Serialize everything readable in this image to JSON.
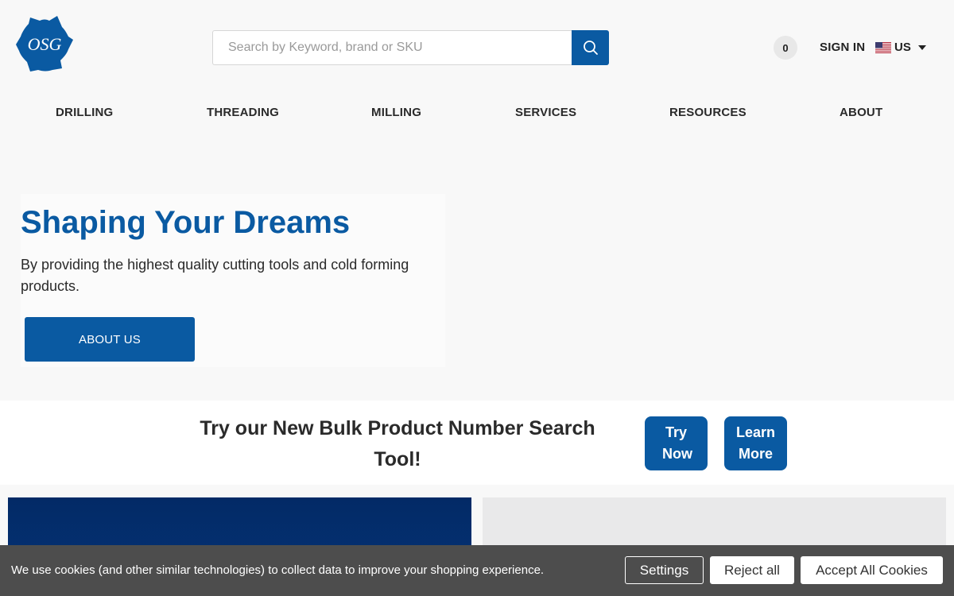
{
  "header": {
    "search": {
      "placeholder": "Search by Keyword, brand or SKU",
      "value": ""
    },
    "cart_count": "0",
    "signin_label": "SIGN IN",
    "locale_label": "US"
  },
  "nav": {
    "items": [
      {
        "label": "DRILLING"
      },
      {
        "label": "THREADING"
      },
      {
        "label": "MILLING"
      },
      {
        "label": "SERVICES"
      },
      {
        "label": "RESOURCES"
      },
      {
        "label": "ABOUT"
      }
    ]
  },
  "hero": {
    "title": "Shaping Your Dreams",
    "subtitle": "By providing the highest quality cutting tools and cold forming products.",
    "cta_label": "ABOUT US"
  },
  "bulk_search": {
    "text": "Try our New Bulk Product Number Search Tool!",
    "try_label": "Try Now",
    "learn_label": "Learn More"
  },
  "cookie_banner": {
    "message": "We use cookies (and other similar technologies) to collect data to improve your shopping experience.",
    "settings_label": "Settings",
    "reject_label": "Reject all",
    "accept_label": "Accept All Cookies"
  },
  "colors": {
    "brand_blue": "#0a5aa2",
    "dark_navy": "#032a66",
    "cookie_bg": "#4d4d4d",
    "page_bg": "#f8f8f8"
  },
  "icons": {
    "logo": "osg-gear-logo",
    "search": "search-icon",
    "flag": "us-flag-icon",
    "dropdown": "chevron-down-icon"
  }
}
